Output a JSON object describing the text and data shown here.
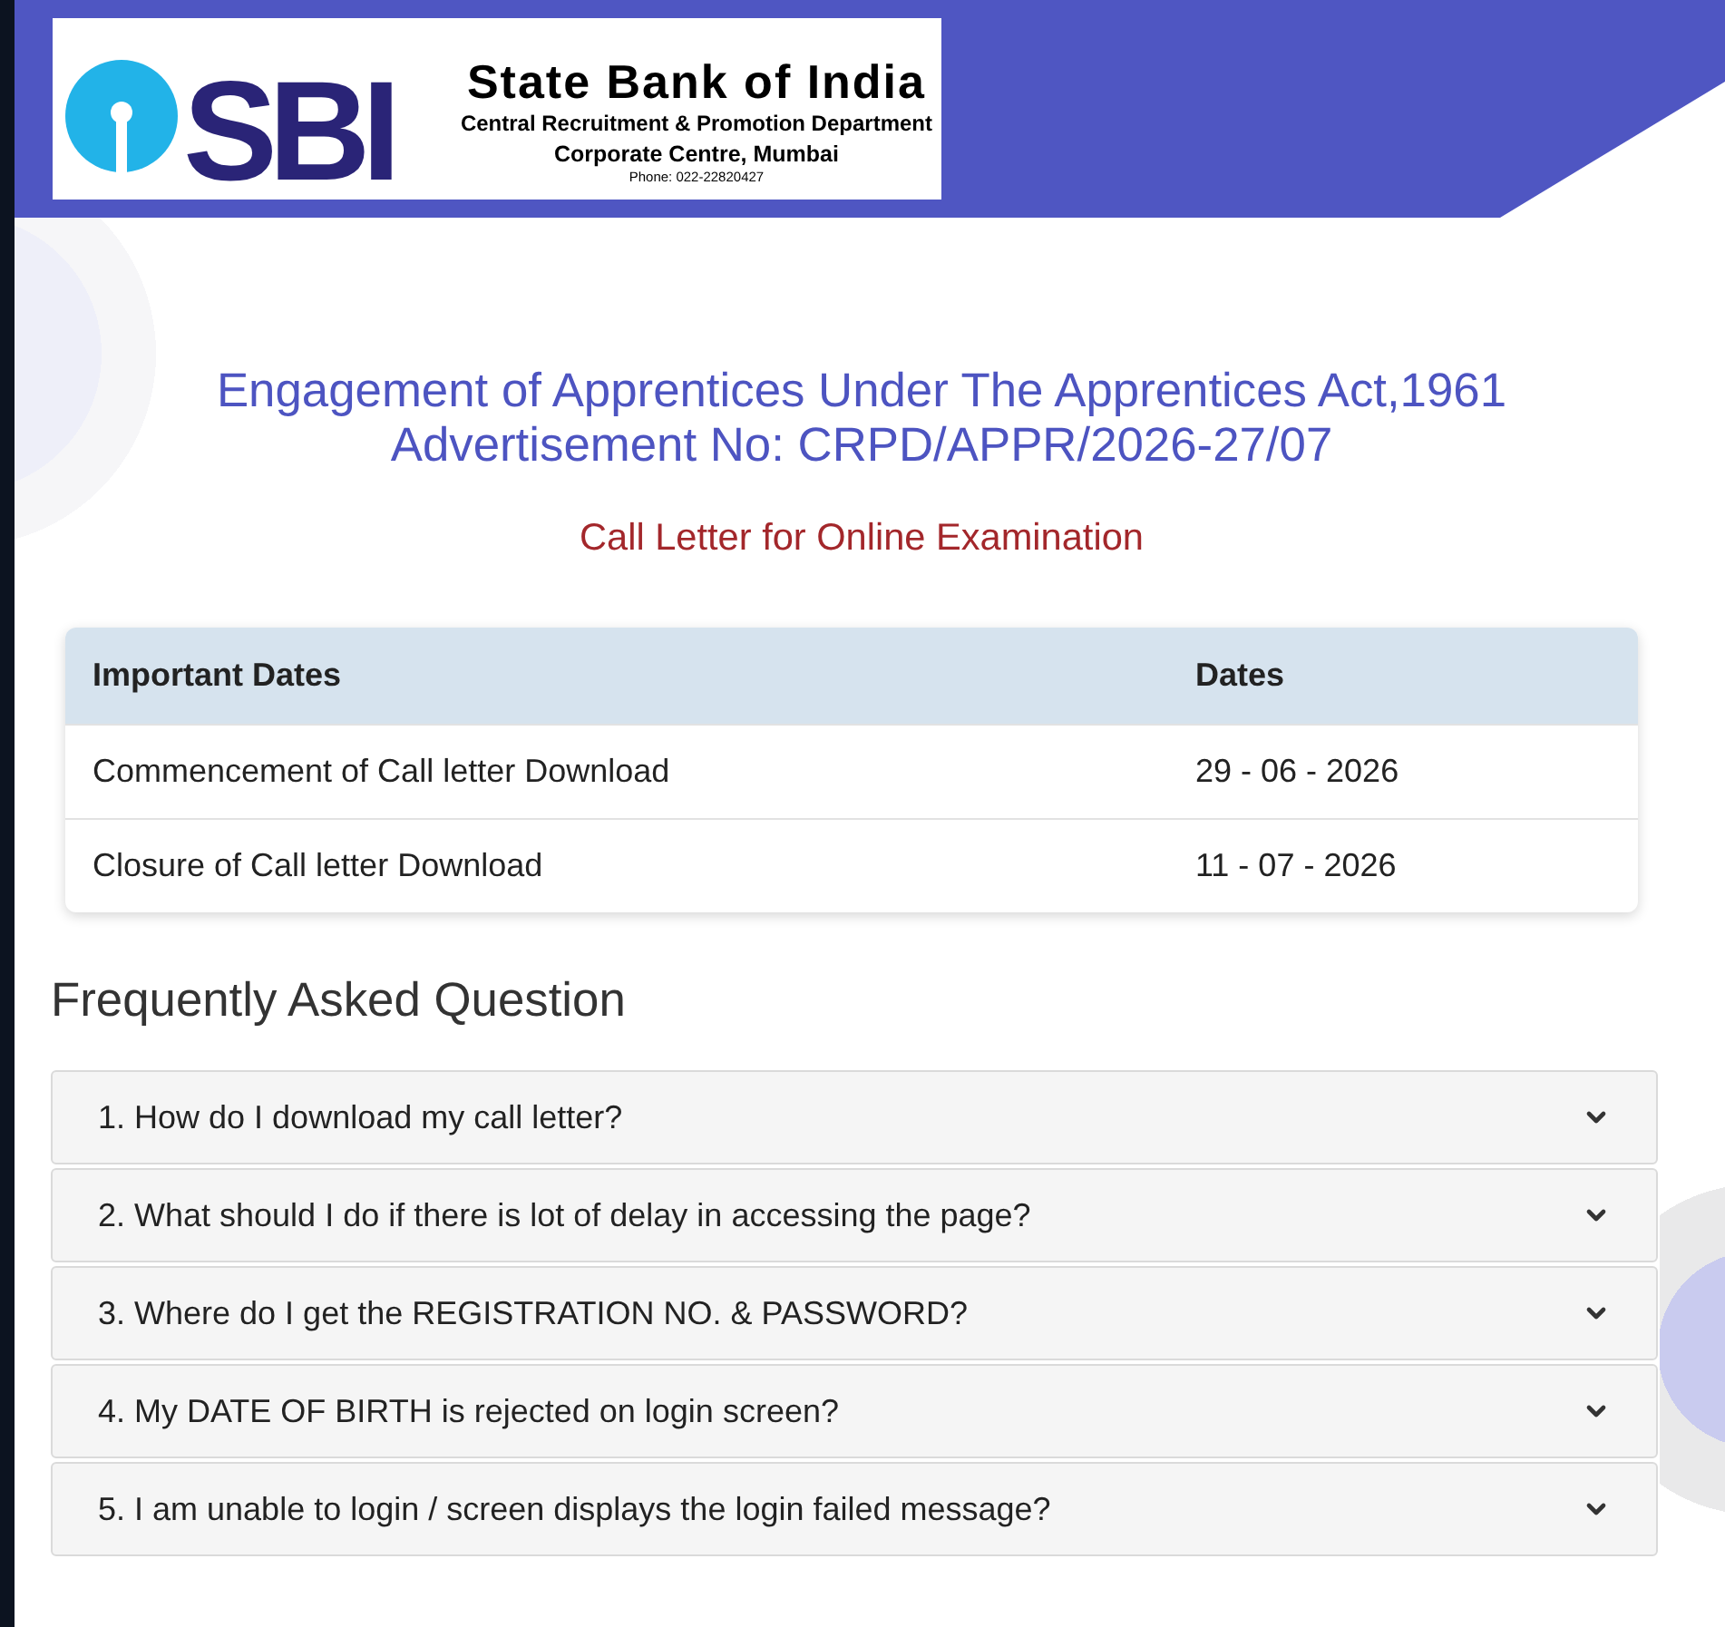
{
  "header": {
    "logo": {
      "wordmark": "SBI",
      "bank_name": "State Bank of India",
      "department": "Central Recruitment & Promotion Department",
      "office": "Corporate Centre, Mumbai",
      "phone": "Phone: 022-22820427"
    }
  },
  "heading": {
    "title": "Engagement of Apprentices Under The Apprentices Act,1961",
    "advertisement": "Advertisement No: CRPD/APPR/2026-27/07",
    "subtitle": "Call Letter for Online Examination"
  },
  "dates_table": {
    "columns": [
      "Important Dates",
      "Dates"
    ],
    "rows": [
      [
        "Commencement of Call letter Download",
        "29 - 06 - 2026"
      ],
      [
        "Closure of Call letter Download",
        "11 - 07 - 2026"
      ]
    ]
  },
  "faq": {
    "title": "Frequently Asked Question",
    "items": [
      {
        "question": "1. How do I download my call letter?",
        "expanded": false
      },
      {
        "question": "2. What should I do if there is lot of delay in accessing the page?",
        "expanded": false
      },
      {
        "question": "3. Where do I get the REGISTRATION NO. & PASSWORD?",
        "expanded": false
      },
      {
        "question": "4. My DATE OF BIRTH is rejected on login screen?",
        "expanded": false
      },
      {
        "question": "5. I am unable to login / screen displays the login failed message?",
        "expanded": false
      }
    ]
  }
}
